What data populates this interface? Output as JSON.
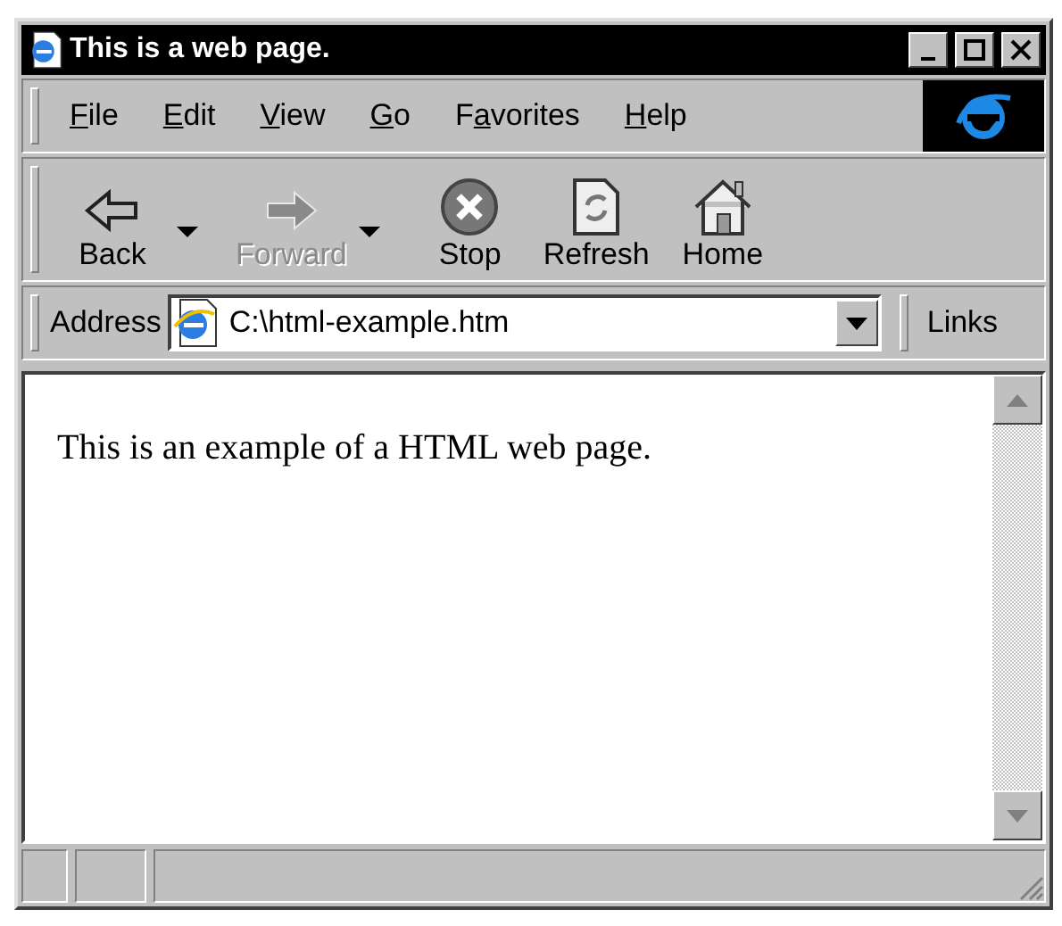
{
  "window": {
    "title": "This is a web page."
  },
  "menu": [
    {
      "key": "F",
      "post": "ile"
    },
    {
      "key": "E",
      "post": "dit"
    },
    {
      "key": "V",
      "post": "iew"
    },
    {
      "key": "G",
      "post": "o"
    },
    {
      "pre": "F",
      "key": "a",
      "post": "vorites"
    },
    {
      "key": "H",
      "post": "elp"
    }
  ],
  "toolbar": [
    {
      "kind": "back",
      "label": "Back",
      "disabled": false,
      "dropdown": true
    },
    {
      "kind": "forward",
      "label": "Forward",
      "disabled": true,
      "dropdown": true
    },
    {
      "kind": "stop",
      "label": "Stop",
      "disabled": false,
      "dropdown": false
    },
    {
      "kind": "refresh",
      "label": "Refresh",
      "disabled": false,
      "dropdown": false
    },
    {
      "kind": "home",
      "label": "Home",
      "disabled": false,
      "dropdown": false
    }
  ],
  "address": {
    "label": "Address",
    "value": "C:\\html-example.htm"
  },
  "links": {
    "label": "Links"
  },
  "page": {
    "text": "This is an example of a HTML web page."
  }
}
